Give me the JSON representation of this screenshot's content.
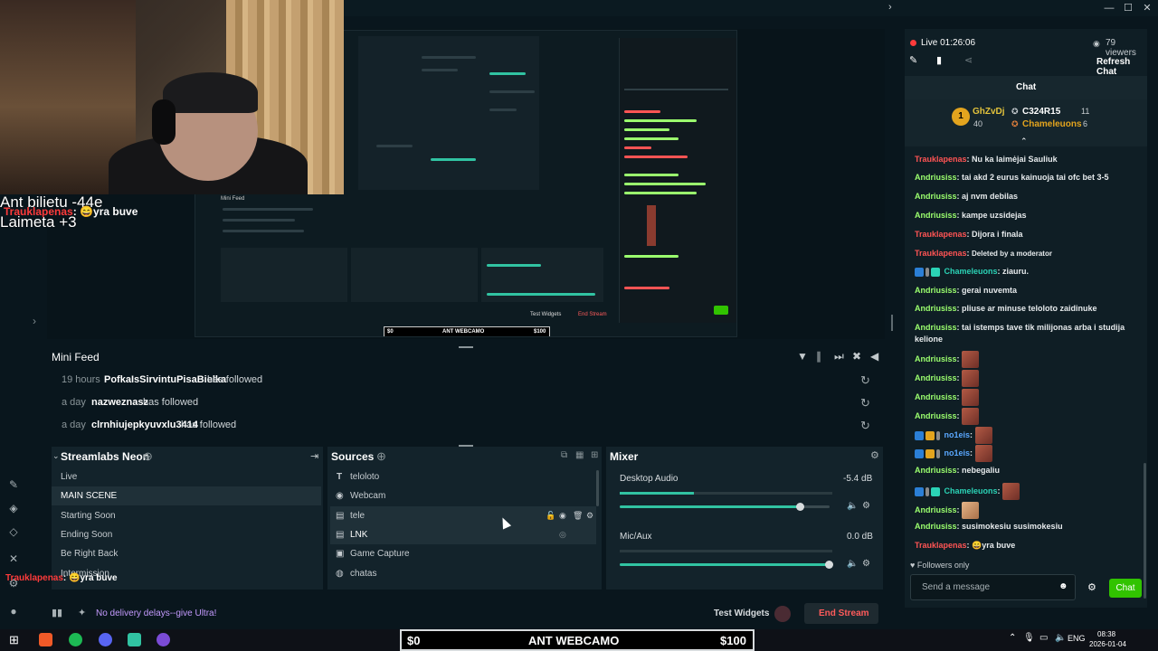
{
  "window": {
    "controls": [
      "—",
      "☐",
      "✕"
    ]
  },
  "overlay": {
    "line1": "Ant bilietu -44e",
    "line2": "Laimeta +3",
    "alert_name": "Trauklapenas",
    "alert_text": "yra buve"
  },
  "preview": {
    "feed_title": "Mini Feed",
    "ticker_left": "$0",
    "ticker_center": "ANT WEBCAMO",
    "ticker_right": "$100",
    "end_stream": "End Stream",
    "test_widgets": "Test Widgets"
  },
  "minifeed": {
    "title": "Mini Feed",
    "rows": [
      {
        "time": "19 hours",
        "user": "PofkaIsSirvintuPisaBielka",
        "action": "has followed"
      },
      {
        "time": "a day",
        "user": "nazweznasz",
        "action": "has followed"
      },
      {
        "time": "a day",
        "user": "clrnhiujepkyuvxlu3414",
        "action": "has followed"
      }
    ]
  },
  "scenes": {
    "title": "Streamlabs Neon",
    "items": [
      "Live",
      "MAIN SCENE",
      "Starting Soon",
      "Ending Soon",
      "Be Right Back",
      "Intermission"
    ],
    "active_index": 1
  },
  "sources": {
    "title": "Sources",
    "items": [
      {
        "icon": "text-icon",
        "label": "teloloto"
      },
      {
        "icon": "webcam-icon",
        "label": "Webcam"
      },
      {
        "icon": "image-icon",
        "label": "tele"
      },
      {
        "icon": "image-icon",
        "label": "LNK"
      },
      {
        "icon": "capture-icon",
        "label": "Game Capture"
      },
      {
        "icon": "globe-icon",
        "label": "chatas"
      }
    ]
  },
  "mixer": {
    "title": "Mixer",
    "channels": [
      {
        "name": "Desktop Audio",
        "db": "-5.4 dB",
        "level": 0.86
      },
      {
        "name": "Mic/Aux",
        "db": "0.0 dB",
        "level": 1.0
      }
    ]
  },
  "statusbar": {
    "ultra_text": "No delivery delays--give Ultra!",
    "test_widgets": "Test Widgets",
    "end_stream": "End Stream"
  },
  "chat": {
    "live_label": "Live 01:26:06",
    "viewers": "79 viewers",
    "refresh": "Refresh Chat",
    "title": "Chat",
    "leaderboard": {
      "first": "GhZvDj",
      "first_score": "40",
      "second": "C324R15",
      "second_score": "11",
      "third": "Chameleuons",
      "third_score": "6"
    },
    "messages": [
      {
        "name": "Trauklapenas",
        "color": "red",
        "text": "Nu ka laimėjai Sauliuk"
      },
      {
        "name": "Andriusiss",
        "color": "green",
        "text": "tai akd 2 eurus kainuoja tai ofc bet 3-5"
      },
      {
        "name": "Andriusiss",
        "color": "green",
        "text": "aj nvm debilas"
      },
      {
        "name": "Andriusiss",
        "color": "green",
        "text": "kampe uzsidejas"
      },
      {
        "name": "Trauklapenas",
        "color": "red",
        "text": "Dijora i finala"
      },
      {
        "name": "Trauklapenas",
        "color": "red",
        "text": "Deleted by a moderator"
      },
      {
        "name": "Chameleuons",
        "color": "teal",
        "text": "ziauru."
      },
      {
        "name": "Andriusiss",
        "color": "green",
        "text": "gerai nuvemta"
      },
      {
        "name": "Andriusiss",
        "color": "green",
        "text": "pliuse ar minuse teloloto zaidinuke"
      },
      {
        "name": "Andriusiss",
        "color": "green",
        "text": "tai istemps tave tik milijonas arba i studija kelione"
      },
      {
        "name": "Andriusiss",
        "color": "green",
        "text": ""
      },
      {
        "name": "Andriusiss",
        "color": "green",
        "text": ""
      },
      {
        "name": "Andriusiss",
        "color": "green",
        "text": ""
      },
      {
        "name": "Andriusiss",
        "color": "green",
        "text": ""
      },
      {
        "name": "no1eis",
        "color": "blue",
        "text": ""
      },
      {
        "name": "no1eis",
        "color": "blue",
        "text": ""
      },
      {
        "name": "Andriusiss",
        "color": "green",
        "text": "nebegaliu"
      },
      {
        "name": "Chameleuons",
        "color": "teal",
        "text": ""
      },
      {
        "name": "Andriusiss",
        "color": "green",
        "text": ""
      },
      {
        "name": "Andriusiss",
        "color": "green",
        "text": "susimokesiu susimokesiu"
      },
      {
        "name": "Trauklapenas",
        "color": "red",
        "text": "yra buve"
      }
    ],
    "followers_only": "Followers only",
    "input_placeholder": "Send a message",
    "send_label": "Chat"
  },
  "ticker": {
    "left": "$0",
    "center": "ANT WEBCAMO",
    "right": "$100"
  },
  "taskbar": {
    "lang": "ENG",
    "time": "08:38",
    "date": "2026-01-04"
  }
}
